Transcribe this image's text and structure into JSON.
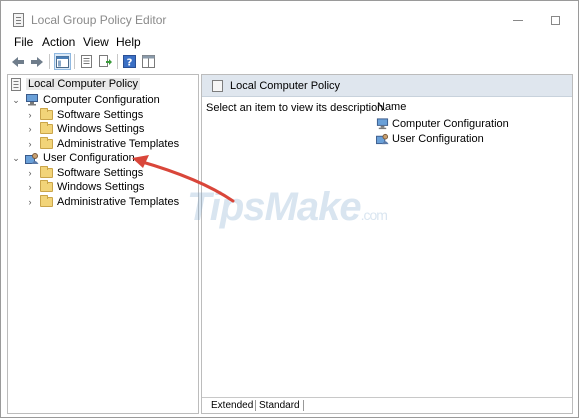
{
  "window": {
    "title": "Local Group Policy Editor"
  },
  "menubar": {
    "items": [
      {
        "label": "File"
      },
      {
        "label": "Action"
      },
      {
        "label": "View"
      },
      {
        "label": "Help"
      }
    ]
  },
  "toolbar": {
    "buttons": [
      "back-icon",
      "forward-icon",
      "show-hide-tree-icon",
      "properties-icon",
      "export-list-icon",
      "help-icon",
      "filter-icon"
    ]
  },
  "tree": {
    "root": {
      "label": "Local Computer Policy"
    },
    "computer": {
      "label": "Computer Configuration",
      "children": [
        {
          "label": "Software Settings"
        },
        {
          "label": "Windows Settings"
        },
        {
          "label": "Administrative Templates"
        }
      ]
    },
    "user": {
      "label": "User Configuration",
      "children": [
        {
          "label": "Software Settings"
        },
        {
          "label": "Windows Settings"
        },
        {
          "label": "Administrative Templates"
        }
      ]
    }
  },
  "details": {
    "header_title": "Local Computer Policy",
    "description": "Select an item to view its description.",
    "column_name": "Name",
    "items": [
      {
        "label": "Computer Configuration"
      },
      {
        "label": "User Configuration"
      }
    ]
  },
  "tabs": [
    {
      "label": "Extended"
    },
    {
      "label": "Standard"
    }
  ],
  "watermark": {
    "text": "TipsMake",
    "suffix": ".com"
  },
  "colors": {
    "arrow": "#d9463a",
    "folder": "#f2d479",
    "header_bg": "#dfe6ee"
  }
}
